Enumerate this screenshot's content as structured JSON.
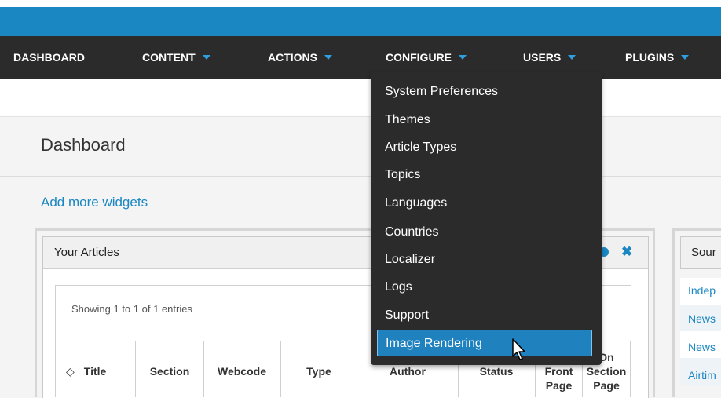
{
  "nav": {
    "items": [
      {
        "label": "DASHBOARD",
        "caret": false
      },
      {
        "label": "CONTENT",
        "caret": true
      },
      {
        "label": "ACTIONS",
        "caret": true
      },
      {
        "label": "CONFIGURE",
        "caret": true
      },
      {
        "label": "USERS",
        "caret": true
      },
      {
        "label": "PLUGINS",
        "caret": true
      }
    ]
  },
  "page": {
    "title": "Dashboard",
    "add_widgets": "Add more widgets"
  },
  "widgets": {
    "articles": {
      "title": "Your Articles",
      "info": "Showing 1 to 1 of 1 entries",
      "columns": [
        "Title",
        "Section",
        "Webcode",
        "Type",
        "Author",
        "Status",
        "Front Page",
        "On Section Page"
      ]
    },
    "sources": {
      "title": "Sour",
      "links": [
        "Indep",
        "News",
        "News",
        "Airtim"
      ]
    }
  },
  "configure_menu": {
    "items": [
      "System Preferences",
      "Themes",
      "Article Types",
      "Topics",
      "Languages",
      "Countries",
      "Localizer",
      "Logs",
      "Support",
      "Image Rendering"
    ],
    "active_index": 9
  },
  "colors": {
    "accent": "#1b87c2",
    "nav_bg": "#2b2b2b",
    "active_item": "#1f82bf"
  }
}
